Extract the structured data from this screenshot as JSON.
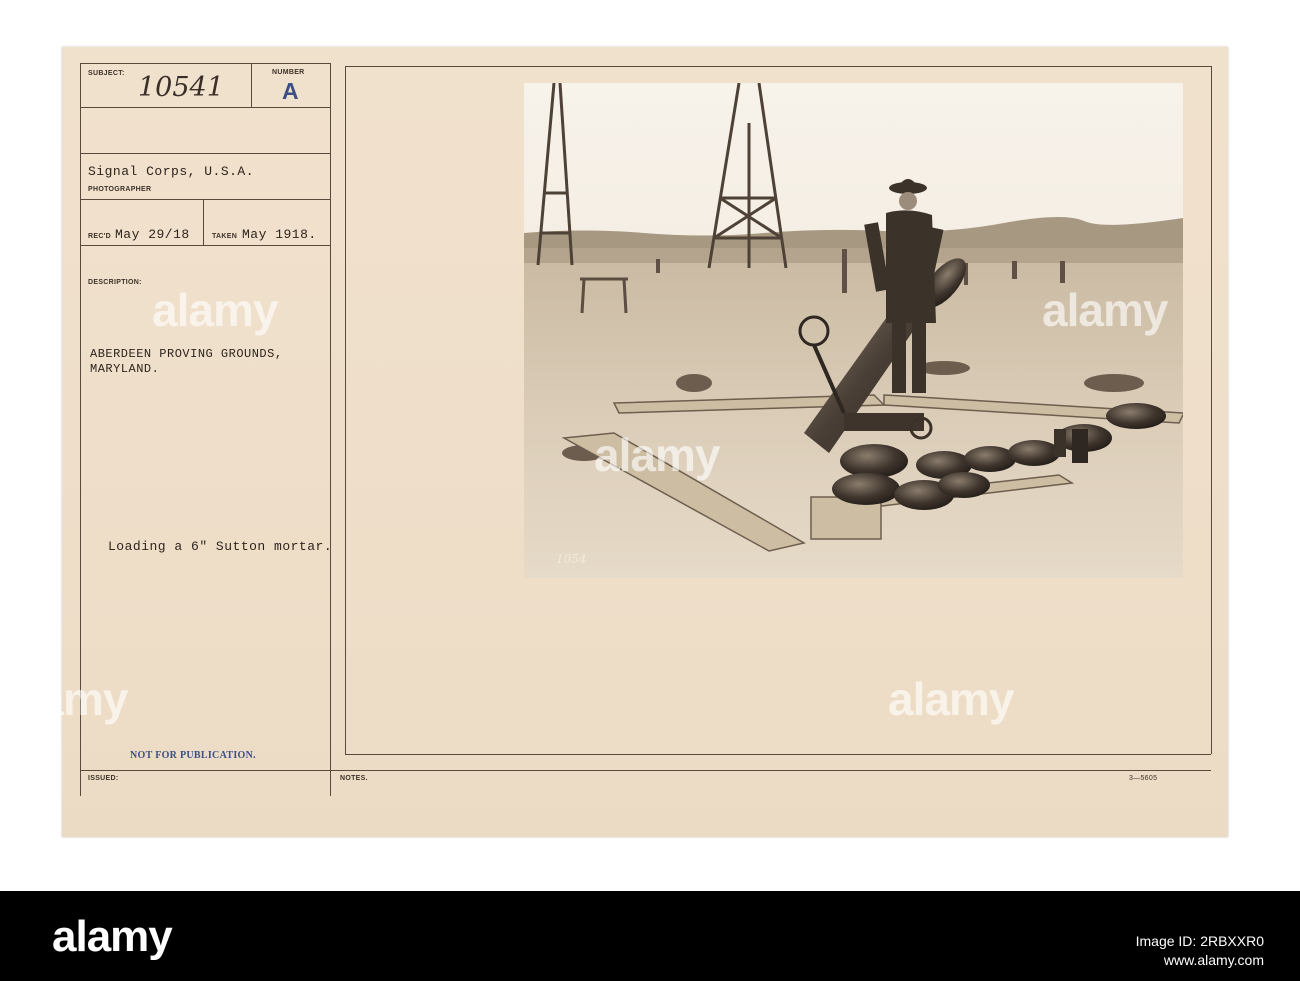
{
  "card": {
    "subject_label": "SUBJECT:",
    "subject_value": "10541",
    "number_label": "NUMBER",
    "number_value": "A",
    "photographer": "Signal Corps, U.S.A.",
    "photographer_label": "PHOTOGRAPHER",
    "recd_label": "REC'D",
    "recd_value": "May 29/18",
    "taken_label": "TAKEN",
    "taken_value": "May 1918.",
    "description_label": "DESCRIPTION:",
    "location_line1": "ABERDEEN PROVING GROUNDS,",
    "location_line2": "MARYLAND.",
    "caption": "Loading a 6\" Sutton mortar.",
    "stamp": "NOT FOR PUBLICATION.",
    "issued_label": "ISSUED:",
    "notes_label": "NOTES.",
    "form_number": "3—5605",
    "negative_number": "1054"
  },
  "watermark": "alamy",
  "footer": {
    "logo": "alamy",
    "image_id": "Image ID: 2RBXXR0",
    "url": "www.alamy.com"
  },
  "colors": {
    "card": "#efdfca",
    "ink": "#2d241d",
    "stamp": "#3c4f86",
    "footer": "#000000"
  }
}
